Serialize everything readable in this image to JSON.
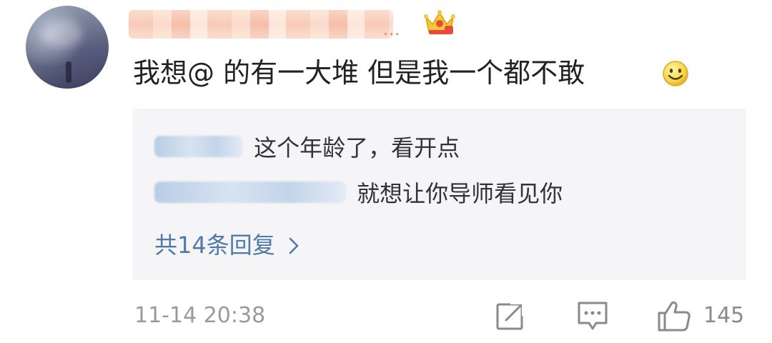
{
  "comment": {
    "text": "我想@ 的有一大堆 但是我一个都不敢",
    "emoji_icon": "smile-emoji-icon",
    "badge_icon": "crown-vip-icon",
    "blurred_name_suffix": "..."
  },
  "replies": {
    "items": [
      {
        "text": "这个年龄了，看开点"
      },
      {
        "text": "就想让你导师看见你"
      }
    ],
    "more_label": "共14条回复",
    "more_icon": "chevron-right-icon"
  },
  "footer": {
    "timestamp": "11-14 20:38",
    "like_count": "145",
    "share_icon": "share-icon",
    "comment_icon": "comment-icon",
    "like_icon": "thumbs-up-icon"
  },
  "colors": {
    "reply_link": "#4f79a8",
    "reply_bg": "#f5f5f7",
    "meta_text": "#9a9a9a"
  }
}
